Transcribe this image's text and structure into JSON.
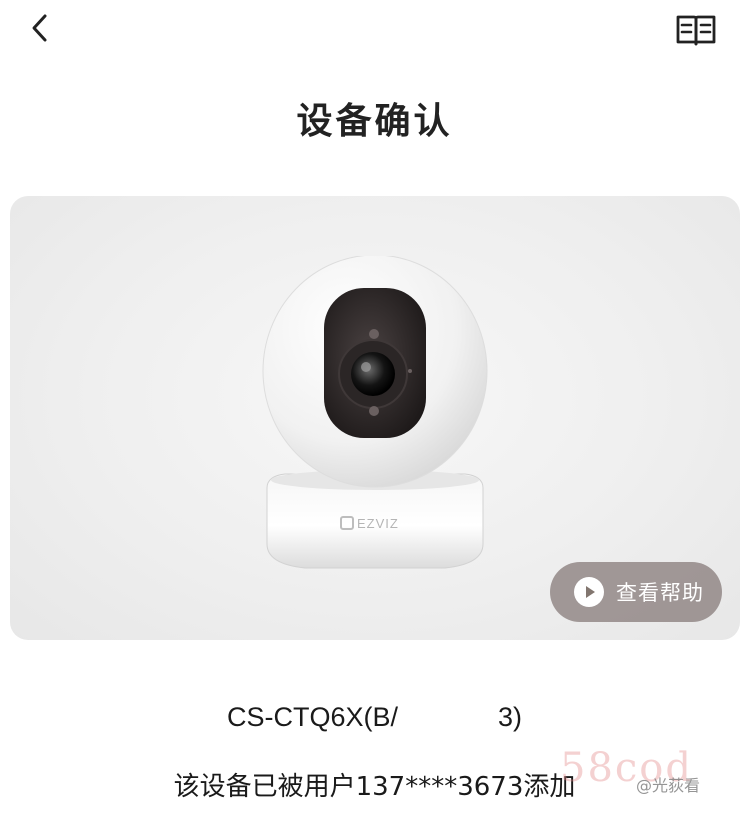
{
  "header": {
    "title": "设备确认",
    "back_icon": "chevron-left-icon",
    "manual_icon": "open-book-icon"
  },
  "product": {
    "brand_logo_text": "EZVIZ",
    "help_button_label": "查看帮助",
    "help_icon": "play-circle-icon"
  },
  "device": {
    "model_prefix": "CS-CTQ6X(B/",
    "model_suffix": "3)",
    "owner_text": "该设备已被用户137****3673添加"
  },
  "watermarks": {
    "main": "58cod",
    "handle": "@光荻看"
  },
  "colors": {
    "text": "#222222",
    "card_bg": "#efefef",
    "help_button_bg": "#82766f"
  }
}
